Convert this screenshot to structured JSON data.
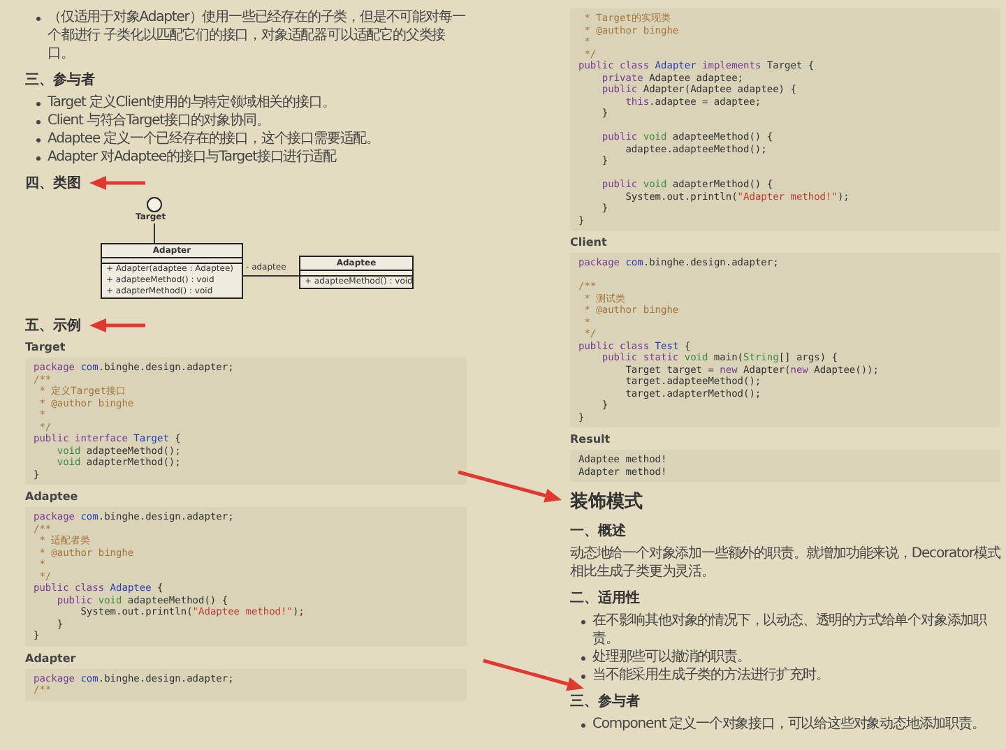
{
  "pages": [
    {
      "blocks": [
        {
          "kind": "bullets",
          "items": [
            "（仅适用于对象Adapter）使用一些已经存在的子类，但是不可能对每一个都进行 子类化以匹配它们的接口，对象适配器可以适配它的父类接口。"
          ]
        },
        {
          "kind": "heading",
          "text": "三、参与者"
        },
        {
          "kind": "bullets",
          "items": [
            "Target 定义Client使用的与特定领域相关的接口。",
            "Client 与符合Target接口的对象协同。",
            "Adaptee 定义一个已经存在的接口，这个接口需要适配。",
            "Adapter 对Adaptee的接口与Target接口进行适配"
          ]
        },
        {
          "kind": "heading",
          "text": "四、类图"
        },
        {
          "kind": "diagram",
          "interface": "Target",
          "classes": [
            {
              "name": "Adapter",
              "members": [
                "+ Adapter(adaptee : Adaptee)",
                "+ adapteeMethod() : void",
                "+ adapterMethod() : void"
              ]
            },
            {
              "name": "Adaptee",
              "members": [
                "+ adapteeMethod() : void"
              ]
            }
          ],
          "association": "- adaptee"
        },
        {
          "kind": "heading",
          "text": "五、示例"
        },
        {
          "kind": "label",
          "text": "Target"
        },
        {
          "kind": "code",
          "lines": [
            {
              "s": [
                {
                  "kind": "kw",
                  "text": "package "
                },
                {
                  "kind": "ty",
                  "text": "com"
                },
                {
                  "kind": "pl",
                  "text": ".binghe.design.adapter;"
                }
              ]
            },
            {
              "s": [
                {
                  "kind": "cm",
                  "text": "/**"
                }
              ]
            },
            {
              "s": [
                {
                  "kind": "cm",
                  "text": " * 定义Target接口"
                }
              ]
            },
            {
              "s": [
                {
                  "kind": "cm",
                  "text": " * @author binghe"
                }
              ]
            },
            {
              "s": [
                {
                  "kind": "cm",
                  "text": " *"
                }
              ]
            },
            {
              "s": [
                {
                  "kind": "cm",
                  "text": " */"
                }
              ]
            },
            {
              "s": [
                {
                  "kind": "kw",
                  "text": "public interface "
                },
                {
                  "kind": "ty",
                  "text": "Target"
                },
                {
                  "kind": "pl",
                  "text": " {"
                }
              ]
            },
            {
              "s": [
                {
                  "kind": "gr",
                  "text": "    void"
                },
                {
                  "kind": "pl",
                  "text": " adapteeMethod();"
                }
              ]
            },
            {
              "s": [
                {
                  "kind": "gr",
                  "text": "    void"
                },
                {
                  "kind": "pl",
                  "text": " adapterMethod();"
                }
              ]
            },
            {
              "s": [
                {
                  "kind": "pl",
                  "text": "}"
                }
              ]
            }
          ]
        },
        {
          "kind": "label",
          "text": "Adaptee"
        },
        {
          "kind": "code",
          "lines": [
            {
              "s": [
                {
                  "kind": "kw",
                  "text": "package "
                },
                {
                  "kind": "ty",
                  "text": "com"
                },
                {
                  "kind": "pl",
                  "text": ".binghe.design.adapter;"
                }
              ]
            },
            {
              "s": [
                {
                  "kind": "cm",
                  "text": "/**"
                }
              ]
            },
            {
              "s": [
                {
                  "kind": "cm",
                  "text": " * 适配者类"
                }
              ]
            },
            {
              "s": [
                {
                  "kind": "cm",
                  "text": " * @author binghe"
                }
              ]
            },
            {
              "s": [
                {
                  "kind": "cm",
                  "text": " *"
                }
              ]
            },
            {
              "s": [
                {
                  "kind": "cm",
                  "text": " */"
                }
              ]
            },
            {
              "s": [
                {
                  "kind": "kw",
                  "text": "public class "
                },
                {
                  "kind": "ty",
                  "text": "Adaptee"
                },
                {
                  "kind": "pl",
                  "text": " {"
                }
              ]
            },
            {
              "s": [
                {
                  "kind": "kw",
                  "text": "    public "
                },
                {
                  "kind": "gr",
                  "text": "void"
                },
                {
                  "kind": "pl",
                  "text": " adapteeMethod() {"
                }
              ]
            },
            {
              "s": [
                {
                  "kind": "pl",
                  "text": "        System.out.println("
                },
                {
                  "kind": "st",
                  "text": "\"Adaptee method!\""
                },
                {
                  "kind": "pl",
                  "text": ");"
                }
              ]
            },
            {
              "s": [
                {
                  "kind": "pl",
                  "text": "    }"
                }
              ]
            },
            {
              "s": [
                {
                  "kind": "pl",
                  "text": "}"
                }
              ]
            }
          ]
        },
        {
          "kind": "label",
          "text": "Adapter"
        },
        {
          "kind": "code",
          "lines": [
            {
              "s": [
                {
                  "kind": "kw",
                  "text": "package "
                },
                {
                  "kind": "ty",
                  "text": "com"
                },
                {
                  "kind": "pl",
                  "text": ".binghe.design.adapter;"
                }
              ]
            },
            {
              "s": [
                {
                  "kind": "cm",
                  "text": "/**"
                }
              ]
            }
          ]
        }
      ]
    },
    {
      "blocks": [
        {
          "kind": "code",
          "lines": [
            {
              "s": [
                {
                  "kind": "cm",
                  "text": " * Target的实现类"
                }
              ]
            },
            {
              "s": [
                {
                  "kind": "cm",
                  "text": " * @author binghe"
                }
              ]
            },
            {
              "s": [
                {
                  "kind": "cm",
                  "text": " *"
                }
              ]
            },
            {
              "s": [
                {
                  "kind": "cm",
                  "text": " */"
                }
              ]
            },
            {
              "s": [
                {
                  "kind": "kw",
                  "text": "public class "
                },
                {
                  "kind": "ty",
                  "text": "Adapter"
                },
                {
                  "kind": "kw",
                  "text": " implements "
                },
                {
                  "kind": "pl",
                  "text": "Target {"
                }
              ]
            },
            {
              "s": [
                {
                  "kind": "kw",
                  "text": "    private "
                },
                {
                  "kind": "pl",
                  "text": "Adaptee adaptee;"
                }
              ]
            },
            {
              "s": [
                {
                  "kind": "kw",
                  "text": "    public "
                },
                {
                  "kind": "pl",
                  "text": "Adapter(Adaptee adaptee) {"
                }
              ]
            },
            {
              "s": [
                {
                  "kind": "kw",
                  "text": "        this"
                },
                {
                  "kind": "pl",
                  "text": ".adaptee = adaptee;"
                }
              ]
            },
            {
              "s": [
                {
                  "kind": "pl",
                  "text": "    }"
                }
              ]
            },
            {
              "s": [
                {
                  "kind": "kw",
                  "text": "    public "
                },
                {
                  "kind": "gr",
                  "text": "void"
                },
                {
                  "kind": "pl",
                  "text": " adapteeMethod() {"
                }
              ],
              "space_before": true
            },
            {
              "s": [
                {
                  "kind": "pl",
                  "text": "        adaptee.adapteeMethod();"
                }
              ]
            },
            {
              "s": [
                {
                  "kind": "pl",
                  "text": "    }"
                }
              ]
            },
            {
              "s": [
                {
                  "kind": "kw",
                  "text": "    public "
                },
                {
                  "kind": "gr",
                  "text": "void"
                },
                {
                  "kind": "pl",
                  "text": " adapterMethod() {"
                }
              ],
              "space_before": true
            },
            {
              "s": [
                {
                  "kind": "pl",
                  "text": "        System.out.println("
                },
                {
                  "kind": "st",
                  "text": "\"Adapter method!\""
                },
                {
                  "kind": "pl",
                  "text": ");"
                }
              ]
            },
            {
              "s": [
                {
                  "kind": "pl",
                  "text": "    }"
                }
              ]
            },
            {
              "s": [
                {
                  "kind": "pl",
                  "text": "}"
                }
              ]
            }
          ]
        },
        {
          "kind": "label",
          "text": "Client"
        },
        {
          "kind": "code",
          "lines": [
            {
              "s": [
                {
                  "kind": "kw",
                  "text": "package "
                },
                {
                  "kind": "ty",
                  "text": "com"
                },
                {
                  "kind": "pl",
                  "text": ".binghe.design.adapter;"
                }
              ]
            },
            {
              "s": [
                {
                  "kind": "cm",
                  "text": "/**"
                }
              ],
              "space_before": true
            },
            {
              "s": [
                {
                  "kind": "cm",
                  "text": " * 测试类"
                }
              ]
            },
            {
              "s": [
                {
                  "kind": "cm",
                  "text": " * @author binghe"
                }
              ]
            },
            {
              "s": [
                {
                  "kind": "cm",
                  "text": " *"
                }
              ]
            },
            {
              "s": [
                {
                  "kind": "cm",
                  "text": " */"
                }
              ]
            },
            {
              "s": [
                {
                  "kind": "kw",
                  "text": "public class "
                },
                {
                  "kind": "ty",
                  "text": "Test"
                },
                {
                  "kind": "pl",
                  "text": " {"
                }
              ]
            },
            {
              "s": [
                {
                  "kind": "kw",
                  "text": "    public static "
                },
                {
                  "kind": "gr",
                  "text": "void"
                },
                {
                  "kind": "pl",
                  "text": " main("
                },
                {
                  "kind": "gr",
                  "text": "String"
                },
                {
                  "kind": "pl",
                  "text": "[] args) {"
                }
              ]
            },
            {
              "s": [
                {
                  "kind": "pl",
                  "text": "        Target target = "
                },
                {
                  "kind": "kw",
                  "text": "new"
                },
                {
                  "kind": "pl",
                  "text": " Adapter("
                },
                {
                  "kind": "kw",
                  "text": "new"
                },
                {
                  "kind": "pl",
                  "text": " Adaptee());"
                }
              ]
            },
            {
              "s": [
                {
                  "kind": "pl",
                  "text": "        target.adapteeMethod();"
                }
              ]
            },
            {
              "s": [
                {
                  "kind": "pl",
                  "text": "        target.adapterMethod();"
                }
              ]
            },
            {
              "s": [
                {
                  "kind": "pl",
                  "text": "    }"
                }
              ]
            },
            {
              "s": [
                {
                  "kind": "pl",
                  "text": "}"
                }
              ]
            }
          ]
        },
        {
          "kind": "label",
          "text": "Result"
        },
        {
          "kind": "code",
          "lines": [
            {
              "s": [
                {
                  "kind": "pl",
                  "text": "Adaptee method!"
                }
              ]
            },
            {
              "s": [
                {
                  "kind": "pl",
                  "text": "Adapter method!"
                }
              ]
            }
          ]
        },
        {
          "kind": "title",
          "text": "装饰模式"
        },
        {
          "kind": "heading",
          "text": "一、概述"
        },
        {
          "kind": "paragraph",
          "text": "动态地给一个对象添加一些额外的职责。就增加功能来说，Decorator模式相比生成子类更为灵活。"
        },
        {
          "kind": "heading",
          "text": "二、适用性"
        },
        {
          "kind": "bullets",
          "items": [
            "在不影响其他对象的情况下，以动态、透明的方式给单个对象添加职责。",
            "处理那些可以撤消的职责。",
            "当不能采用生成子类的方法进行扩充时。"
          ]
        },
        {
          "kind": "heading",
          "text": "三、参与者"
        },
        {
          "kind": "bullets",
          "items": [
            "Component 定义一个对象接口，可以给这些对象动态地添加职责。"
          ]
        }
      ]
    }
  ]
}
